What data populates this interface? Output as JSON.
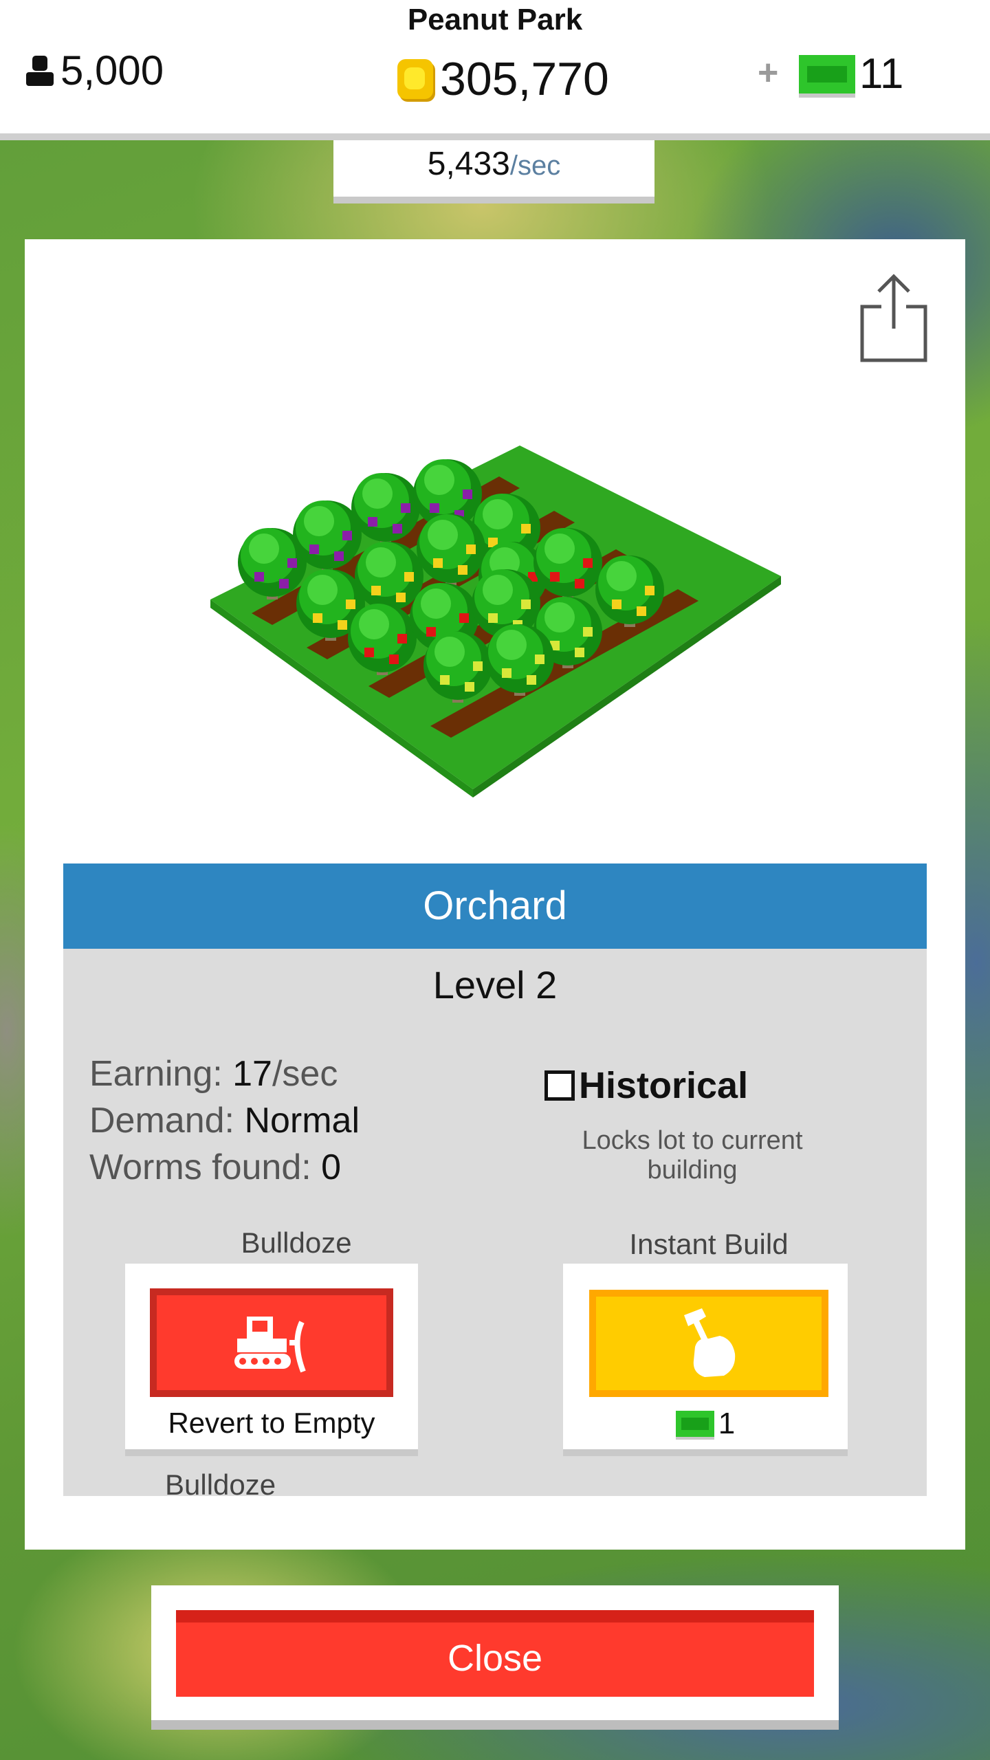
{
  "header": {
    "park_name": "Peanut Park",
    "population": "5,000",
    "coins": "305,770",
    "plus": "+",
    "bucks": "11",
    "rate_value": "5,433",
    "rate_unit": "/sec"
  },
  "building": {
    "name": "Orchard",
    "level": "Level 2",
    "earning_label": "Earning:",
    "earning_value": "17",
    "earning_unit": "/sec",
    "demand_label": "Demand:",
    "demand_value": "Normal",
    "worms_label": "Worms found:",
    "worms_value": "0",
    "historical_label": "Historical",
    "historical_checked": false,
    "historical_sub": "Locks lot to current building"
  },
  "actions": {
    "bulldoze_label": "Bulldoze",
    "bulldoze_button_text": "Revert to Empty",
    "instant_label": "Instant Build",
    "instant_cost": "1"
  },
  "close_label": "Close",
  "colors": {
    "title_bar": "#2e86c1",
    "bulldoze": "#ff3a2d",
    "instant_build": "#ffcc00",
    "close": "#ff3a2d",
    "cash": "#2ec52b",
    "coin": "#f5c400"
  },
  "icons": [
    "person-icon",
    "coin-icon",
    "cash-icon",
    "share-icon",
    "bulldozer-icon",
    "hammer-hand-icon"
  ]
}
